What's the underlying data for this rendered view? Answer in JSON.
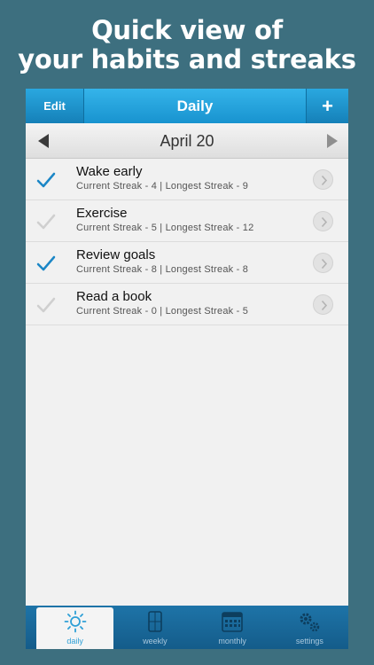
{
  "headline": {
    "line1": "Quick view of",
    "line2": "your habits and streaks"
  },
  "topbar": {
    "edit_label": "Edit",
    "title": "Daily",
    "add_label": "+"
  },
  "datebar": {
    "date": "April 20"
  },
  "habits": [
    {
      "name": "Wake early",
      "streak": "Current Streak - 4 | Longest Streak - 9",
      "checked": true
    },
    {
      "name": "Exercise",
      "streak": "Current Streak - 5 | Longest Streak - 12",
      "checked": false
    },
    {
      "name": "Review goals",
      "streak": "Current Streak - 8 | Longest Streak - 8",
      "checked": true
    },
    {
      "name": "Read a book",
      "streak": "Current Streak - 0 | Longest Streak - 5",
      "checked": false
    }
  ],
  "tabs": [
    {
      "label": "daily",
      "icon": "sun-icon",
      "active": true
    },
    {
      "label": "weekly",
      "icon": "weekly-calendar-icon",
      "active": false
    },
    {
      "label": "monthly",
      "icon": "monthly-calendar-icon",
      "active": false
    },
    {
      "label": "settings",
      "icon": "gears-icon",
      "active": false
    }
  ],
  "colors": {
    "background": "#3d6f7f",
    "accent": "#1e9bd7",
    "check_on": "#1b86c6",
    "check_off": "#cfcfcf"
  }
}
